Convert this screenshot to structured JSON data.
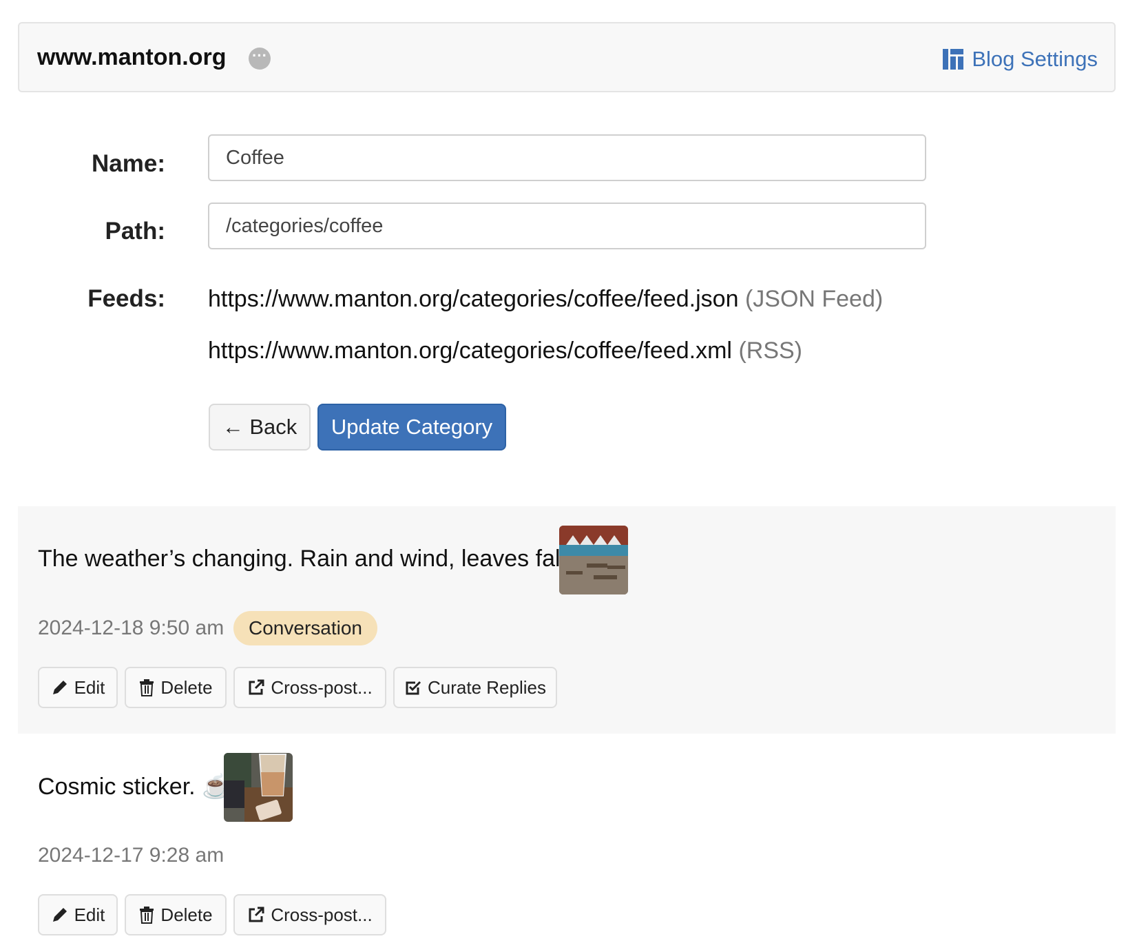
{
  "header": {
    "site_title": "www.manton.org",
    "blog_settings_label": "Blog Settings",
    "accent_color": "#3d72b8"
  },
  "form": {
    "name_label": "Name:",
    "name_value": "Coffee",
    "path_label": "Path:",
    "path_value": "/categories/coffee",
    "feeds_label": "Feeds:",
    "feeds": [
      {
        "url": "https://www.manton.org/categories/coffee/feed.json",
        "kind": "(JSON Feed)"
      },
      {
        "url": "https://www.manton.org/categories/coffee/feed.xml",
        "kind": "(RSS)"
      }
    ],
    "back_label": "← Back",
    "update_label": "Update Category"
  },
  "posts": [
    {
      "text": "The weather’s changing. Rain and wind, leaves fall...",
      "date": "2024-12-18 9:50 am",
      "badge": "Conversation",
      "thumbnail_icon": "outdoor-patio-photo",
      "actions": {
        "edit": "Edit",
        "delete": "Delete",
        "crosspost": "Cross-post...",
        "curate": "Curate Replies"
      }
    },
    {
      "text": "Cosmic sticker. ☕️",
      "date": "2024-12-17 9:28 am",
      "thumbnail_icon": "iced-coffee-photo",
      "actions": {
        "edit": "Edit",
        "delete": "Delete",
        "crosspost": "Cross-post..."
      }
    }
  ]
}
